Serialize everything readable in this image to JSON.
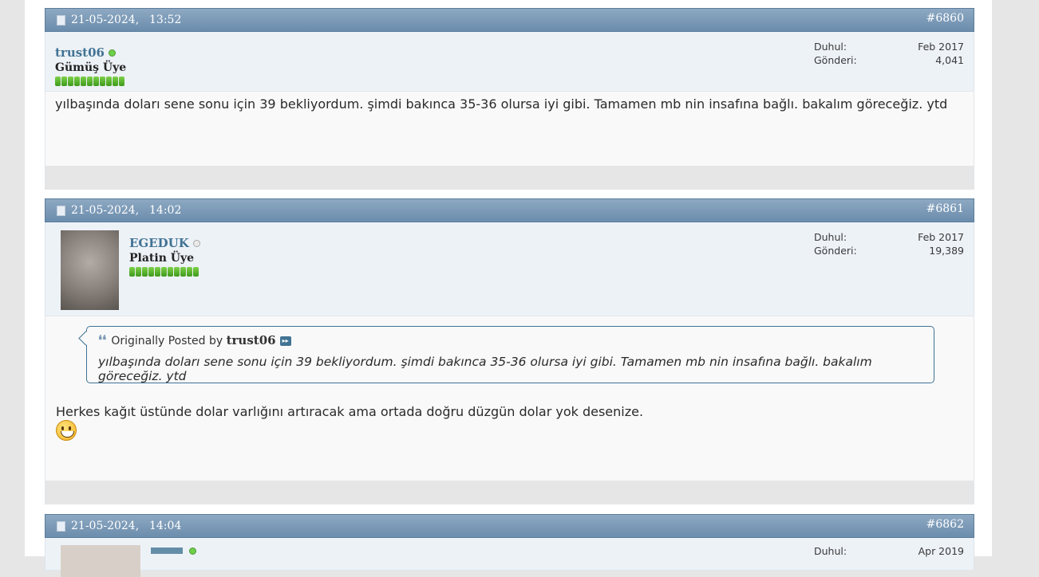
{
  "posts": [
    {
      "date": "21-05-2024,",
      "time": "13:52",
      "number": "#6860",
      "username": "trust06",
      "rank": "Gümüş Üye",
      "joined_label": "Duhul:",
      "joined_value": "Feb 2017",
      "posts_label": "Gönderi:",
      "posts_value": "4,041",
      "message": "yılbaşında doları sene sonu için 39 bekliyordum. şimdi bakınca 35-36 olursa iyi gibi. Tamamen mb nin insafına bağlı. bakalım göreceğiz. ytd",
      "online": true
    },
    {
      "date": "21-05-2024,",
      "time": "14:02",
      "number": "#6861",
      "username": "EGEDUK",
      "rank": "Platin Üye",
      "joined_label": "Duhul:",
      "joined_value": "Feb 2017",
      "posts_label": "Gönderi:",
      "posts_value": "19,389",
      "quote_prefix": "Originally Posted by",
      "quote_author": "trust06",
      "quote_text": "yılbaşında doları sene sonu için 39 bekliyordum. şimdi bakınca 35-36 olursa iyi gibi. Tamamen mb nin insafına bağlı. bakalım göreceğiz. ytd",
      "message": "Herkes kağıt üstünde dolar varlığını artıracak ama ortada doğru düzgün dolar yok desenize.",
      "online": false
    },
    {
      "date": "21-05-2024,",
      "time": "14:04",
      "number": "#6862",
      "joined_label": "Duhul:",
      "joined_value": "Apr 2019"
    }
  ],
  "icons": {
    "doc": "post-document-icon",
    "online": "online-status-icon",
    "offline": "offline-status-icon",
    "quote": "quote-icon",
    "view_post": "view-post-icon",
    "smiley": "grin-smiley-icon"
  },
  "colors": {
    "header_bar": "#6c8dad",
    "username": "#417394",
    "reputation": "#5cb82c"
  }
}
